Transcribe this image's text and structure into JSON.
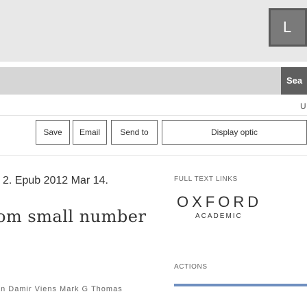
{
  "header": {
    "top_right_button_text": "L"
  },
  "search": {
    "button_label": "Sea",
    "placeholder": ""
  },
  "user_text": "U",
  "toolbar": {
    "buttons": [
      "Save",
      "Email",
      "Send to",
      "Display optic"
    ]
  },
  "article": {
    "citation": "2. Epub 2012 Mar 14.",
    "title": "om small number",
    "authors": "an Damir Viens Mark G Thomas"
  },
  "sidebar": {
    "full_text_links_label": "FULL TEXT LINKS",
    "publisher_logo": {
      "name": "OXFORD",
      "sub": "ACADEMIC"
    },
    "actions_label": "ACTIONS"
  },
  "colors": {
    "accent": "#6f8fbf",
    "search_button": "#5f5f5f"
  }
}
